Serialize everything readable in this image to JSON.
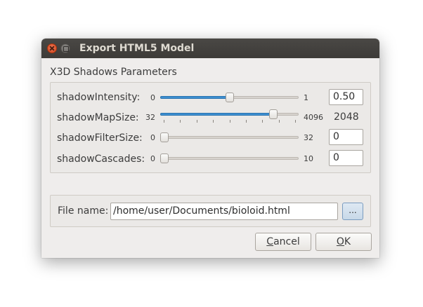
{
  "window": {
    "title": "Export HTML5 Model"
  },
  "shadows": {
    "group_title": "X3D Shadows Parameters",
    "rows": [
      {
        "label": "shadowIntensity:",
        "min": "0",
        "max": "1",
        "value": "0.50",
        "value_fraction": 0.5
      },
      {
        "label": "shadowMapSize:",
        "min": "32",
        "max": "4096",
        "value": "2048",
        "value_fraction": 0.84
      },
      {
        "label": "shadowFilterSize:",
        "min": "0",
        "max": "32",
        "value": "0",
        "value_fraction": 0
      },
      {
        "label": "shadowCascades:",
        "min": "0",
        "max": "10",
        "value": "0",
        "value_fraction": 0
      }
    ]
  },
  "file": {
    "label": "File name:",
    "value": "/home/user/Documents/bioloid.html",
    "browse_label": "..."
  },
  "buttons": {
    "cancel_mnemonic": "C",
    "cancel_rest": "ancel",
    "ok_mnemonic": "O",
    "ok_rest": "K"
  },
  "colors": {
    "accent": "#3d8fd0",
    "titlebar": "#3d3b38",
    "close_button": "#e0552c"
  }
}
